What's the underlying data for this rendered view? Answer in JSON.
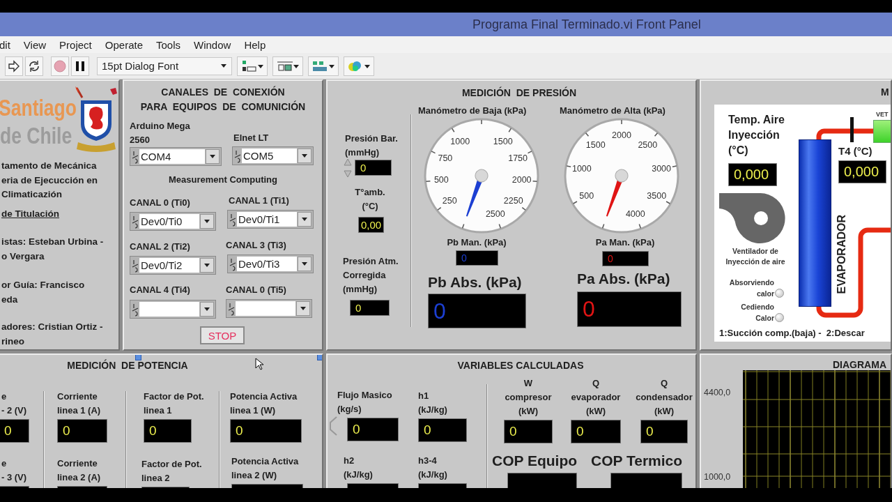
{
  "window": {
    "title": "Programa Final Terminado.vi Front Panel"
  },
  "menu": [
    "dit",
    "View",
    "Project",
    "Operate",
    "Tools",
    "Window",
    "Help"
  ],
  "toolbar": {
    "font": "15pt Dialog Font"
  },
  "info_panel": {
    "logo": [
      "Santiago",
      "de Chile"
    ],
    "paragraphs": [
      {
        "lines": [
          "tamento de Mecánica",
          "eria de Ejecucción en",
          "Climaticazión"
        ],
        "underlined": false
      },
      {
        "lines": [
          "de Titulación"
        ],
        "underlined": true
      },
      {
        "lines": [
          "istas: Esteban Urbina -",
          "o Vergara"
        ],
        "underlined": false
      },
      {
        "lines": [
          "or Guía: Francisco",
          "eda"
        ],
        "underlined": false
      },
      {
        "lines": [
          "adores: Cristian Ortiz -",
          "rineo"
        ],
        "underlined": false
      }
    ]
  },
  "channels_panel": {
    "title": "CANALES  DE  CONEXIÓN\nPARA  EQUIPOS  DE  COMUNICIÓN",
    "ports": [
      {
        "label": "Arduino Mega\n2560",
        "value": "COM4"
      },
      {
        "label": "Elnet LT",
        "value": "COM5"
      }
    ],
    "section": "Measurement Computing",
    "channels": [
      {
        "label": "CANAL 0 (Ti0)",
        "value": "Dev0/Ti0"
      },
      {
        "label": "CANAL 1 (Ti1)",
        "value": "Dev0/Ti1"
      },
      {
        "label": "CANAL 2 (Ti2)",
        "value": "Dev0/Ti2"
      },
      {
        "label": "CANAL 3 (Ti3)",
        "value": "Dev0/Ti3"
      },
      {
        "label": "CANAL 4 (Ti4)"
      },
      {
        "label": "CANAL 0 (Ti5)"
      }
    ],
    "stop_button": "STOP"
  },
  "pressure_panel": {
    "title": "MEDICIÓN  DE PRESIÓN",
    "inputs": [
      {
        "label": "Presión Bar.\n(mmHg)",
        "value": "0",
        "kind": "control"
      },
      {
        "label": "T°amb.\n(°C)",
        "value": "0,00",
        "kind": "indicator"
      },
      {
        "label": "Presión Atm.\nCorregida\n(mmHg)",
        "value": "0",
        "kind": "indicator"
      }
    ],
    "gauges": [
      {
        "title": "Manómetro de Baja (kPa)",
        "ticks": [
          "250",
          "500",
          "750",
          "1000",
          "1500",
          "1750",
          "2000",
          "2250",
          "2500"
        ],
        "color": "#1c3fd2",
        "reading_label": "Pb Man. (kPa)",
        "reading": "0",
        "abs_label": "Pb Abs. (kPa)",
        "abs_value": "0"
      },
      {
        "title": "Manómetro de Alta (kPa)",
        "ticks": [
          "500",
          "1000",
          "1500",
          "2000",
          "2500",
          "3000",
          "3500",
          "4000"
        ],
        "color": "#e01414",
        "reading_label": "Pa Man. (kPa)",
        "reading": "0",
        "abs_label": "Pa Abs. (kPa)",
        "abs_value": "0"
      }
    ]
  },
  "right_panel": {
    "title": "M",
    "air_temp": {
      "label": "Temp. Aire\nInyección\n(°C)",
      "value": "0,000"
    },
    "t4": {
      "label": "T4 (°C)",
      "value": "0,000"
    },
    "valve_label": "VET",
    "evaporator": "EVAPORADOR",
    "fan_label": "Ventilador de\nInyección de aire",
    "leds": [
      {
        "label": "Absorviendo\ncalor",
        "on": false
      },
      {
        "label": "Cediendo\nCalor",
        "on": false
      }
    ],
    "footer": "1:Succión comp.(baja) -  2:Descar"
  },
  "power_panel": {
    "title": "MEDICIÓN  DE POTENCIA",
    "fields": [
      {
        "label": "e\n- 2 (V)",
        "value": "0"
      },
      {
        "label": "Corriente\nlinea 1 (A)",
        "value": "0"
      },
      {
        "label": "Factor de Pot.\nlinea 1",
        "value": "0"
      },
      {
        "label": "Potencia Activa\nlinea 1 (W)",
        "value": "0"
      },
      {
        "label": "e\n- 3 (V)"
      },
      {
        "label": "Corriente\nlinea 2 (A)"
      },
      {
        "label": "Factor de Pot.\nlinea 2"
      },
      {
        "label": "Potencia Activa\nlinea 2 (W)"
      }
    ]
  },
  "variables_panel": {
    "title": "VARIABLES CALCULADAS",
    "fields": [
      {
        "label": "Flujo Masico\n(kg/s)",
        "value": "0"
      },
      {
        "label": "h1\n(kJ/kg)",
        "value": "0"
      },
      {
        "label": "W\ncompresor\n(kW)",
        "value": "0"
      },
      {
        "label": "Q\nevaporador\n(kW)",
        "value": "0"
      },
      {
        "label": "Q\ncondensador\n(kW)",
        "value": "0"
      },
      {
        "label": "h2\n(kJ/kg)"
      },
      {
        "label": "h3-4\n(kJ/kg)"
      }
    ],
    "cop": [
      {
        "label": "COP Equipo"
      },
      {
        "label": "COP Termico"
      }
    ]
  },
  "diagram_panel": {
    "title": "DIAGRAMA",
    "y_labels": [
      "4400,0",
      "1000,0"
    ]
  }
}
